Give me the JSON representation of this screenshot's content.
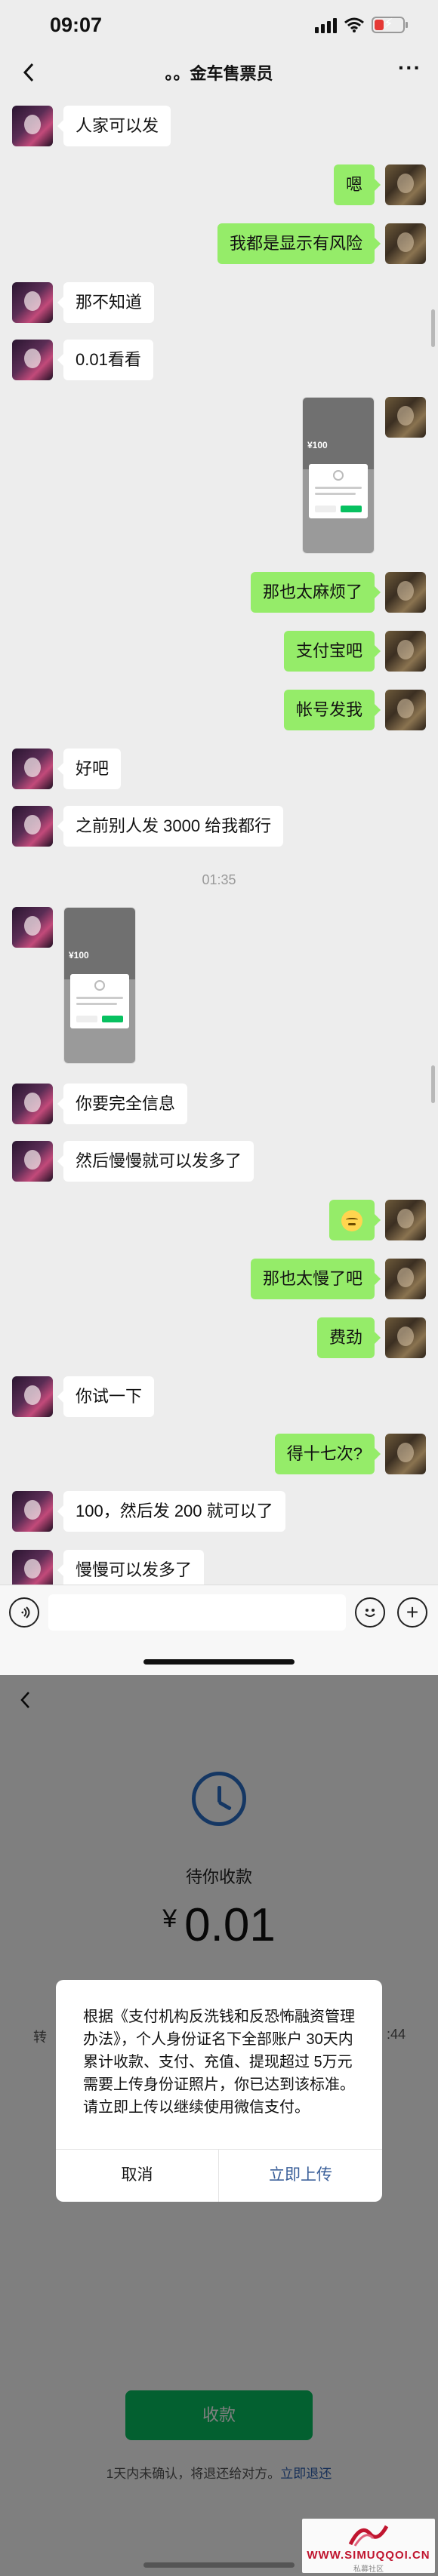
{
  "status_bar": {
    "time": "09:07"
  },
  "header": {
    "title": "。。金车售票员"
  },
  "messages": [
    {
      "side": "left",
      "text": "人家可以发"
    },
    {
      "side": "right",
      "text": "嗯"
    },
    {
      "side": "right",
      "text": "我都是显示有风险"
    },
    {
      "side": "left",
      "text": "那不知道"
    },
    {
      "side": "left",
      "text": "0.01看看"
    },
    {
      "side": "right",
      "type": "image",
      "amount": "¥100"
    },
    {
      "side": "right",
      "text": "那也太麻烦了"
    },
    {
      "side": "right",
      "text": "支付宝吧"
    },
    {
      "side": "right",
      "text": "帐号发我"
    },
    {
      "side": "left",
      "text": "好吧"
    },
    {
      "side": "left",
      "text": "之前别人发 3000 给我都行"
    },
    {
      "type": "time",
      "text": "01:35"
    },
    {
      "side": "left",
      "type": "image",
      "amount": "¥100"
    },
    {
      "side": "left",
      "text": "你要完全信息"
    },
    {
      "side": "left",
      "text": "然后慢慢就可以发多了"
    },
    {
      "side": "right",
      "type": "emoji",
      "emoji": "slightly-smiling-face"
    },
    {
      "side": "right",
      "text": "那也太慢了吧"
    },
    {
      "side": "right",
      "text": "费劲"
    },
    {
      "side": "left",
      "text": "你试一下"
    },
    {
      "side": "right",
      "text": "得十七次?"
    },
    {
      "side": "left",
      "text": "100，然后发 200 就可以了"
    },
    {
      "side": "left",
      "text": "慢慢可以发多了"
    }
  ],
  "payment": {
    "status": "待你收款",
    "currency": "¥",
    "amount": "0.01",
    "partial_left": "转",
    "partial_right": ":44",
    "dialog": {
      "message": "根据《支付机构反洗钱和反恐怖融资管理办法》，个人身份证名下全部账户 30天内累计收款、支付、充值、提现超过 5万元需要上传身份证照片，你已达到该标准。请立即上传以继续使用微信支付。",
      "cancel": "取消",
      "confirm": "立即上传"
    },
    "receive_button": "收款",
    "note_text": "1天内未确认，将退还给对方。",
    "note_link": "立即退还"
  },
  "watermark": {
    "text": "WWW.SIMUQQOI.CN",
    "sub": "私募社区"
  },
  "colors": {
    "chat_bg": "#ededed",
    "bubble_out": "#95ec69",
    "bubble_in": "#ffffff",
    "wechat_green": "#07c160",
    "link_blue": "#3a5f99",
    "clock_blue": "#2a6fc7"
  },
  "icons": [
    "back-arrow-icon",
    "more-icon",
    "voice-icon",
    "emoji-icon",
    "plus-icon",
    "clock-icon",
    "wifi-icon",
    "battery-icon",
    "signal-icon"
  ]
}
